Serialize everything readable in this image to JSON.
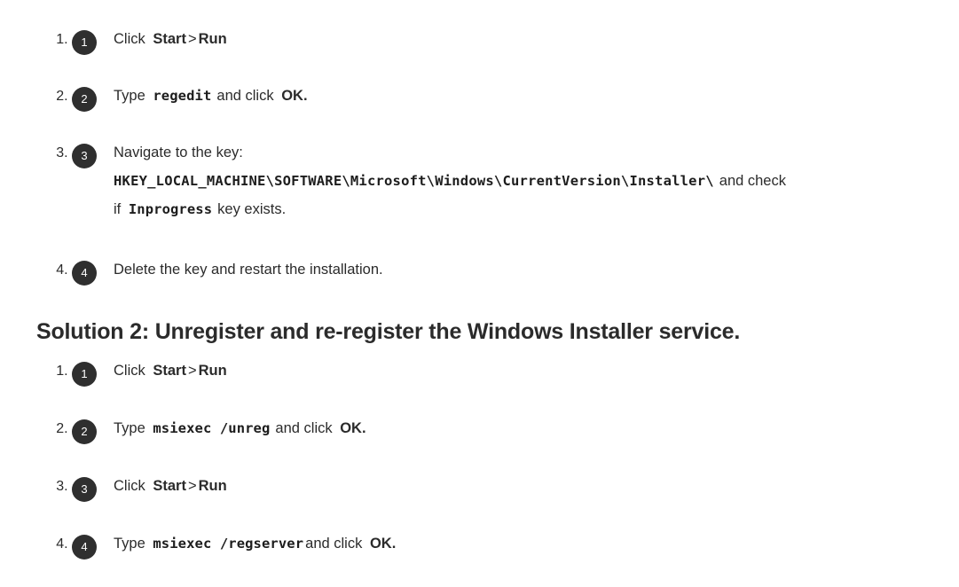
{
  "document": {
    "background_color": "#ffffff",
    "text_color": "#2b2b2b",
    "marker_color": "#2f2f2f",
    "marker_text_color": "#ffffff"
  },
  "solution_one": {
    "steps": [
      {
        "number": "1",
        "lead": "Click",
        "target": "Start",
        "separator": ">",
        "target2": "Run"
      },
      {
        "number": "2",
        "lead": "Type",
        "code": "regedit",
        "mid": "and click",
        "emphasis": "OK."
      },
      {
        "number": "3",
        "lead": "Navigate to the key:",
        "code_path": "HKEY_LOCAL_MACHINE\\SOFTWARE\\Microsoft\\Windows\\CurrentVersion\\Installer\\",
        "after_path": "and check",
        "tail_lead": "if",
        "tail_code": "Inprogress",
        "tail_rest": "key exists."
      },
      {
        "number": "4",
        "text": "Delete the key and restart the installation."
      }
    ]
  },
  "heading": {
    "text": "Solution 2: Unregister and re-register the Windows Installer service."
  },
  "solution_two": {
    "steps": [
      {
        "number": "1",
        "lead": "Click",
        "target": "Start",
        "separator": ">",
        "target2": "Run"
      },
      {
        "number": "2",
        "lead": "Type",
        "code": "msiexec /unreg",
        "mid": "and click",
        "emphasis": "OK."
      },
      {
        "number": "3",
        "lead": "Click",
        "target": "Start",
        "separator": ">",
        "target2": "Run"
      },
      {
        "number": "4",
        "lead": "Type",
        "code": "msiexec /regserver",
        "mid": "and click",
        "emphasis": "OK."
      }
    ]
  }
}
